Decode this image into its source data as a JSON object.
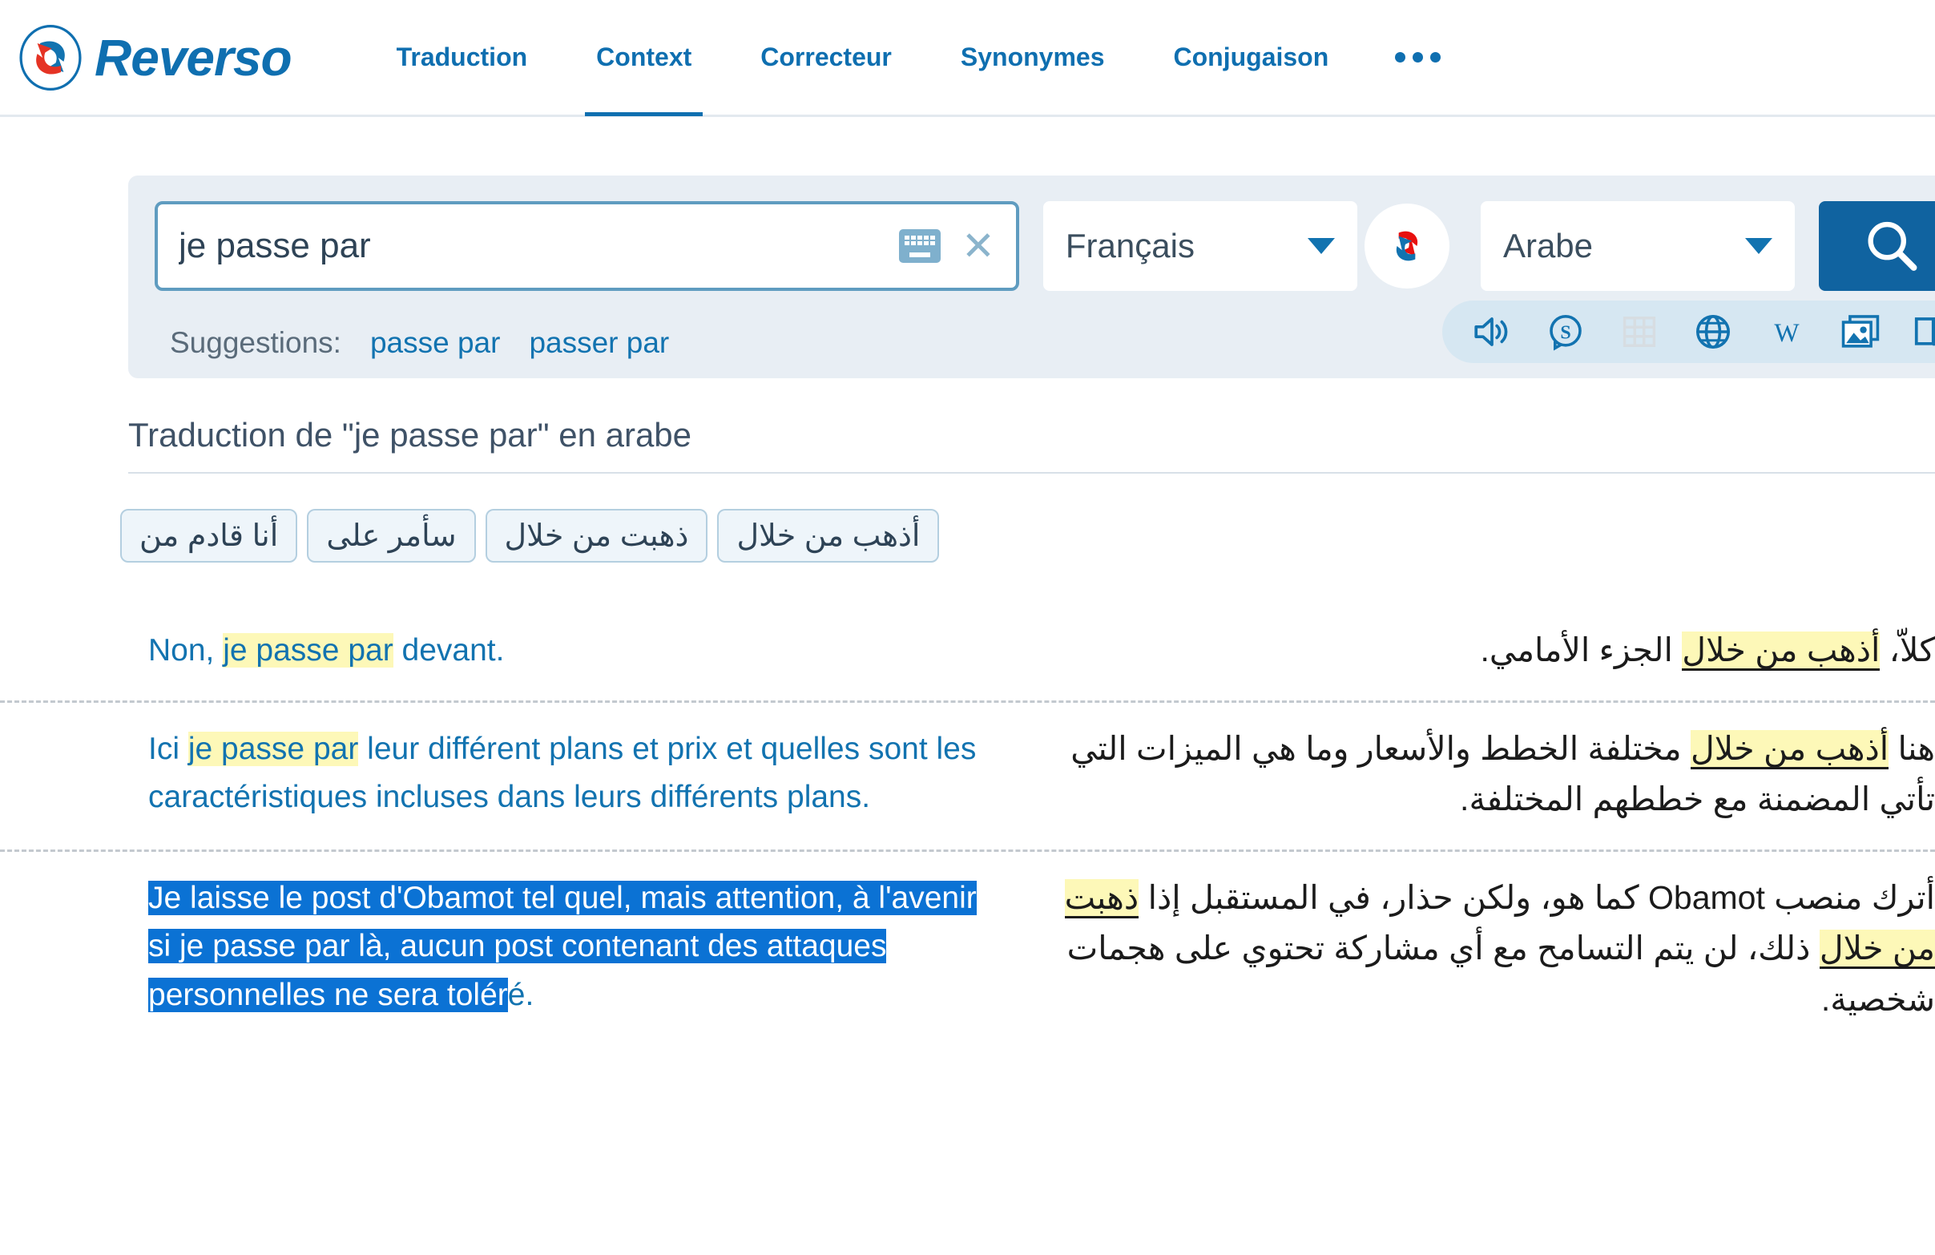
{
  "brand": {
    "name": "Reverso",
    "logo_icon": "reverso-circular-arrows-logo"
  },
  "nav": {
    "items": [
      {
        "label": "Traduction",
        "active": false
      },
      {
        "label": "Context",
        "active": true
      },
      {
        "label": "Correcteur",
        "active": false
      },
      {
        "label": "Synonymes",
        "active": false
      },
      {
        "label": "Conjugaison",
        "active": false
      }
    ],
    "more_icon": "ellipsis-icon"
  },
  "search": {
    "query": "je passe par",
    "placeholder": "je passe par",
    "keyboard_icon": "virtual-keyboard-icon",
    "clear_icon": "close-icon",
    "source_language": "Français",
    "target_language": "Arabe",
    "swap_icon": "swap-languages-icon",
    "search_icon": "search-icon"
  },
  "suggestions": {
    "label": "Suggestions:",
    "items": [
      "passe par",
      "passer par"
    ]
  },
  "tools": [
    {
      "name": "pronounce-icon",
      "disabled": false
    },
    {
      "name": "synonyms-icon",
      "disabled": false
    },
    {
      "name": "conjugation-table-icon",
      "disabled": true
    },
    {
      "name": "globe-icon",
      "disabled": false
    },
    {
      "name": "wikipedia-icon",
      "disabled": false
    },
    {
      "name": "images-icon",
      "disabled": false
    },
    {
      "name": "dictionary-book-icon",
      "disabled": false
    }
  ],
  "result": {
    "title": "Traduction de \"je passe par\" en arabe",
    "collapse_icon": "chevron-down-icon"
  },
  "translation_chips": [
    "أذهب من خلال",
    "ذهبت من خلال",
    "سأمر على",
    "أنا قادم من"
  ],
  "examples": [
    {
      "fr": {
        "pre": "Non, ",
        "highlight": "je passe par",
        "post": " devant."
      },
      "ar": {
        "pre": "كلاّ، ",
        "highlight": "أذهب من خلال",
        "post": " الجزء الأمامي."
      }
    },
    {
      "fr": {
        "pre": "Ici ",
        "highlight": "je passe par",
        "post": " leur différent plans et prix et quelles sont les caractéristiques incluses dans leurs différents plans."
      },
      "ar": {
        "pre": "هنا ",
        "highlight": "أذهب من خلال",
        "post": " مختلفة الخطط والأسعار وما هي الميزات التي تأتي المضمنة مع خططهم المختلفة."
      }
    },
    {
      "fr": {
        "selected": "Je laisse le post d'Obamot tel quel, mais attention, à l'avenir si je passe par là, aucun post contenant des attaques personnelles ne sera tolér",
        "tail": "é."
      },
      "ar": {
        "pre": "أترك منصب Obamot كما هو، ولكن حذار، في المستقبل إذا ",
        "highlight": "ذهبت من خلال",
        "post": " ذلك، لن يتم التسامح مع أي مشاركة تحتوي على هجمات شخصية."
      }
    }
  ],
  "colors": {
    "brand_blue": "#0f6fb0",
    "accent_blue": "#1063a0",
    "panel_bg": "#e8eef4",
    "highlight_yellow": "#fdf8b8",
    "selection_blue": "#0b72d4",
    "text_dark": "#2e4356"
  }
}
